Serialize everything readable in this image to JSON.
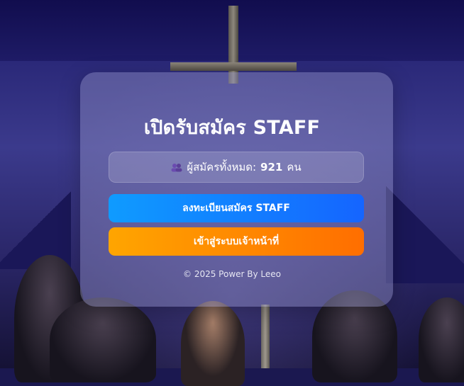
{
  "card": {
    "title": "เปิดรับสมัคร STAFF",
    "stat": {
      "icon": "people-icon",
      "label": "ผู้สมัครทั้งหมด:",
      "count": "921",
      "unit": "คน"
    },
    "buttons": {
      "register_label": "ลงทะเบียนสมัคร STAFF",
      "login_label": "เข้าสู่ระบบเจ้าหน้าที่"
    },
    "footer": "© 2025 Power By Leeo"
  },
  "colors": {
    "register_button": "#1565ff",
    "login_button": "#ff6e00",
    "background": "#2a2878"
  }
}
